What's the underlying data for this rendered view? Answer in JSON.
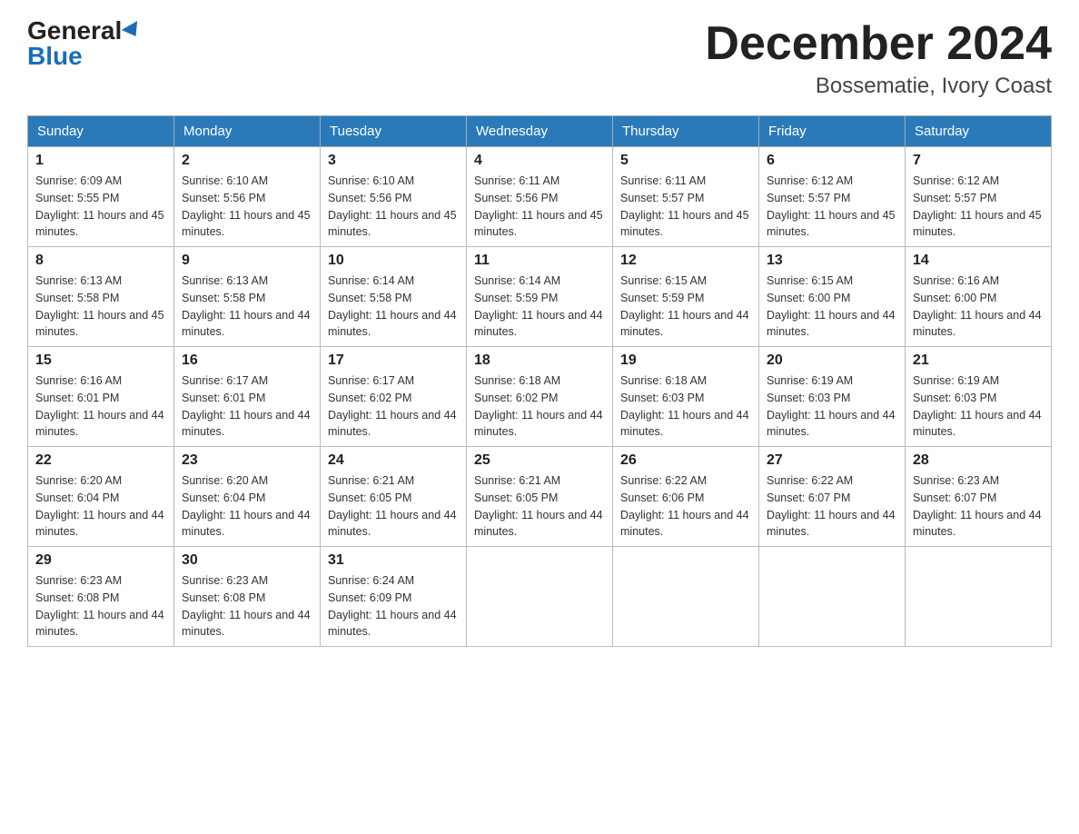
{
  "header": {
    "logo_general": "General",
    "logo_blue": "Blue",
    "title": "December 2024",
    "subtitle": "Bossematie, Ivory Coast"
  },
  "days_of_week": [
    "Sunday",
    "Monday",
    "Tuesday",
    "Wednesday",
    "Thursday",
    "Friday",
    "Saturday"
  ],
  "weeks": [
    [
      {
        "day": "1",
        "sunrise": "6:09 AM",
        "sunset": "5:55 PM",
        "daylight": "11 hours and 45 minutes."
      },
      {
        "day": "2",
        "sunrise": "6:10 AM",
        "sunset": "5:56 PM",
        "daylight": "11 hours and 45 minutes."
      },
      {
        "day": "3",
        "sunrise": "6:10 AM",
        "sunset": "5:56 PM",
        "daylight": "11 hours and 45 minutes."
      },
      {
        "day": "4",
        "sunrise": "6:11 AM",
        "sunset": "5:56 PM",
        "daylight": "11 hours and 45 minutes."
      },
      {
        "day": "5",
        "sunrise": "6:11 AM",
        "sunset": "5:57 PM",
        "daylight": "11 hours and 45 minutes."
      },
      {
        "day": "6",
        "sunrise": "6:12 AM",
        "sunset": "5:57 PM",
        "daylight": "11 hours and 45 minutes."
      },
      {
        "day": "7",
        "sunrise": "6:12 AM",
        "sunset": "5:57 PM",
        "daylight": "11 hours and 45 minutes."
      }
    ],
    [
      {
        "day": "8",
        "sunrise": "6:13 AM",
        "sunset": "5:58 PM",
        "daylight": "11 hours and 45 minutes."
      },
      {
        "day": "9",
        "sunrise": "6:13 AM",
        "sunset": "5:58 PM",
        "daylight": "11 hours and 44 minutes."
      },
      {
        "day": "10",
        "sunrise": "6:14 AM",
        "sunset": "5:58 PM",
        "daylight": "11 hours and 44 minutes."
      },
      {
        "day": "11",
        "sunrise": "6:14 AM",
        "sunset": "5:59 PM",
        "daylight": "11 hours and 44 minutes."
      },
      {
        "day": "12",
        "sunrise": "6:15 AM",
        "sunset": "5:59 PM",
        "daylight": "11 hours and 44 minutes."
      },
      {
        "day": "13",
        "sunrise": "6:15 AM",
        "sunset": "6:00 PM",
        "daylight": "11 hours and 44 minutes."
      },
      {
        "day": "14",
        "sunrise": "6:16 AM",
        "sunset": "6:00 PM",
        "daylight": "11 hours and 44 minutes."
      }
    ],
    [
      {
        "day": "15",
        "sunrise": "6:16 AM",
        "sunset": "6:01 PM",
        "daylight": "11 hours and 44 minutes."
      },
      {
        "day": "16",
        "sunrise": "6:17 AM",
        "sunset": "6:01 PM",
        "daylight": "11 hours and 44 minutes."
      },
      {
        "day": "17",
        "sunrise": "6:17 AM",
        "sunset": "6:02 PM",
        "daylight": "11 hours and 44 minutes."
      },
      {
        "day": "18",
        "sunrise": "6:18 AM",
        "sunset": "6:02 PM",
        "daylight": "11 hours and 44 minutes."
      },
      {
        "day": "19",
        "sunrise": "6:18 AM",
        "sunset": "6:03 PM",
        "daylight": "11 hours and 44 minutes."
      },
      {
        "day": "20",
        "sunrise": "6:19 AM",
        "sunset": "6:03 PM",
        "daylight": "11 hours and 44 minutes."
      },
      {
        "day": "21",
        "sunrise": "6:19 AM",
        "sunset": "6:03 PM",
        "daylight": "11 hours and 44 minutes."
      }
    ],
    [
      {
        "day": "22",
        "sunrise": "6:20 AM",
        "sunset": "6:04 PM",
        "daylight": "11 hours and 44 minutes."
      },
      {
        "day": "23",
        "sunrise": "6:20 AM",
        "sunset": "6:04 PM",
        "daylight": "11 hours and 44 minutes."
      },
      {
        "day": "24",
        "sunrise": "6:21 AM",
        "sunset": "6:05 PM",
        "daylight": "11 hours and 44 minutes."
      },
      {
        "day": "25",
        "sunrise": "6:21 AM",
        "sunset": "6:05 PM",
        "daylight": "11 hours and 44 minutes."
      },
      {
        "day": "26",
        "sunrise": "6:22 AM",
        "sunset": "6:06 PM",
        "daylight": "11 hours and 44 minutes."
      },
      {
        "day": "27",
        "sunrise": "6:22 AM",
        "sunset": "6:07 PM",
        "daylight": "11 hours and 44 minutes."
      },
      {
        "day": "28",
        "sunrise": "6:23 AM",
        "sunset": "6:07 PM",
        "daylight": "11 hours and 44 minutes."
      }
    ],
    [
      {
        "day": "29",
        "sunrise": "6:23 AM",
        "sunset": "6:08 PM",
        "daylight": "11 hours and 44 minutes."
      },
      {
        "day": "30",
        "sunrise": "6:23 AM",
        "sunset": "6:08 PM",
        "daylight": "11 hours and 44 minutes."
      },
      {
        "day": "31",
        "sunrise": "6:24 AM",
        "sunset": "6:09 PM",
        "daylight": "11 hours and 44 minutes."
      },
      null,
      null,
      null,
      null
    ]
  ]
}
